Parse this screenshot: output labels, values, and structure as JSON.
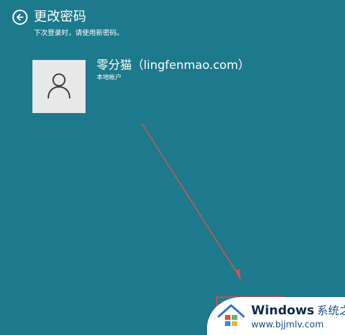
{
  "header": {
    "title": "更改密码",
    "subtitle": "下次登录时，请使用新密码。"
  },
  "user": {
    "name": "零分猫（lingfenmao.com）",
    "account_type": "本地帐户"
  },
  "watermark": {
    "brand": "Windows",
    "brand_cn": "系统之家",
    "url": "www.bjjmlv.com"
  },
  "icons": {
    "back": "arrow-left-circle-icon",
    "avatar": "user-silhouette-icon",
    "logo": "windows-house-logo-icon"
  },
  "colors": {
    "background": "#1c7a8c",
    "avatar_bg": "#e8e8e8",
    "annotation": "#d9534f"
  }
}
